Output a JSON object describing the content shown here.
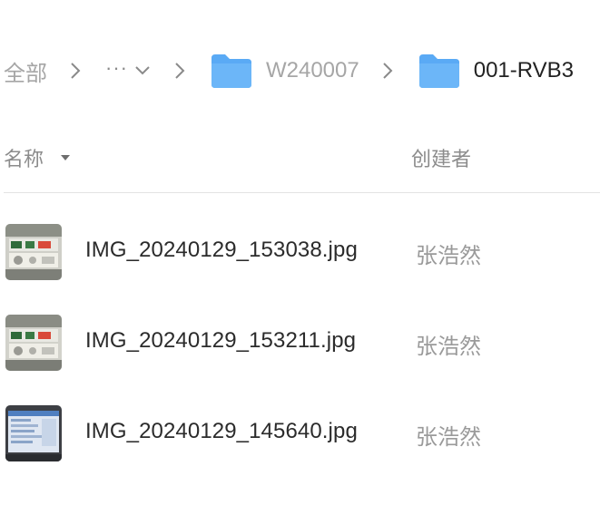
{
  "breadcrumb": {
    "root": "全部",
    "more": "···",
    "parent_folder": "W240007",
    "current_folder": "001-RVB3"
  },
  "columns": {
    "name": "名称",
    "creator": "创建者"
  },
  "files": [
    {
      "name": "IMG_20240129_153038.jpg",
      "creator": "张浩然",
      "thumb": "instrument-photo-icon"
    },
    {
      "name": "IMG_20240129_153211.jpg",
      "creator": "张浩然",
      "thumb": "instrument-photo-icon"
    },
    {
      "name": "IMG_20240129_145640.jpg",
      "creator": "张浩然",
      "thumb": "screen-photo-icon"
    }
  ],
  "colors": {
    "folder": "#5aaaf5",
    "divider": "#e3e3e3",
    "muted_text": "#a6a6a6"
  }
}
